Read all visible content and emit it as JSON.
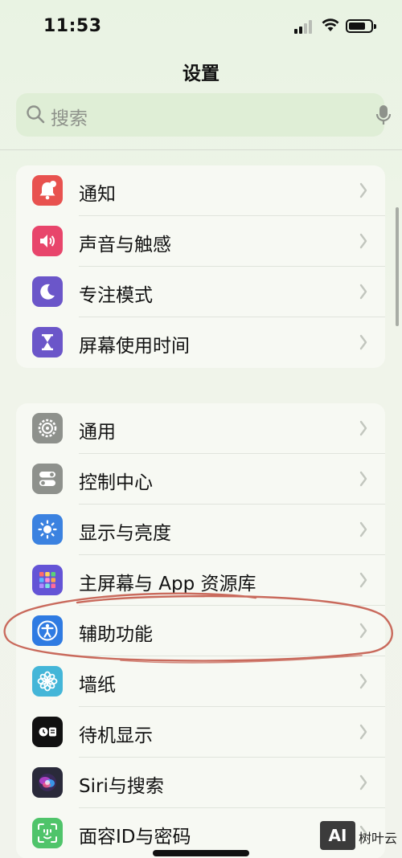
{
  "status": {
    "time": "11:53"
  },
  "header": {
    "title": "设置"
  },
  "search": {
    "placeholder": "搜索"
  },
  "groups": [
    {
      "items": [
        {
          "label": "通知",
          "icon": "bell-icon",
          "color": "#e8524f"
        },
        {
          "label": "声音与触感",
          "icon": "speaker-icon",
          "color": "#e8456b"
        },
        {
          "label": "专注模式",
          "icon": "moon-icon",
          "color": "#6b56c9"
        },
        {
          "label": "屏幕使用时间",
          "icon": "hourglass-icon",
          "color": "#6b56c9"
        }
      ]
    },
    {
      "items": [
        {
          "label": "通用",
          "icon": "gear-icon",
          "color": "#8e918c"
        },
        {
          "label": "控制中心",
          "icon": "toggles-icon",
          "color": "#8e918c"
        },
        {
          "label": "显示与亮度",
          "icon": "sun-icon",
          "color": "#3b82e0"
        },
        {
          "label": "主屏幕与 App 资源库",
          "icon": "grid-icon",
          "color": "#6454d6"
        },
        {
          "label": "辅助功能",
          "icon": "accessibility-icon",
          "color": "#2f7be2"
        },
        {
          "label": "墙纸",
          "icon": "flower-icon",
          "color": "#44b6d8"
        },
        {
          "label": "待机显示",
          "icon": "standby-icon",
          "color": "#111111"
        },
        {
          "label": "Siri与搜索",
          "icon": "siri-icon",
          "color": "#2a2a3a"
        },
        {
          "label": "面容ID与密码",
          "icon": "faceid-icon",
          "color": "#4fc46a"
        }
      ]
    }
  ],
  "watermark": {
    "badge": "AI",
    "text": "树叶云"
  }
}
